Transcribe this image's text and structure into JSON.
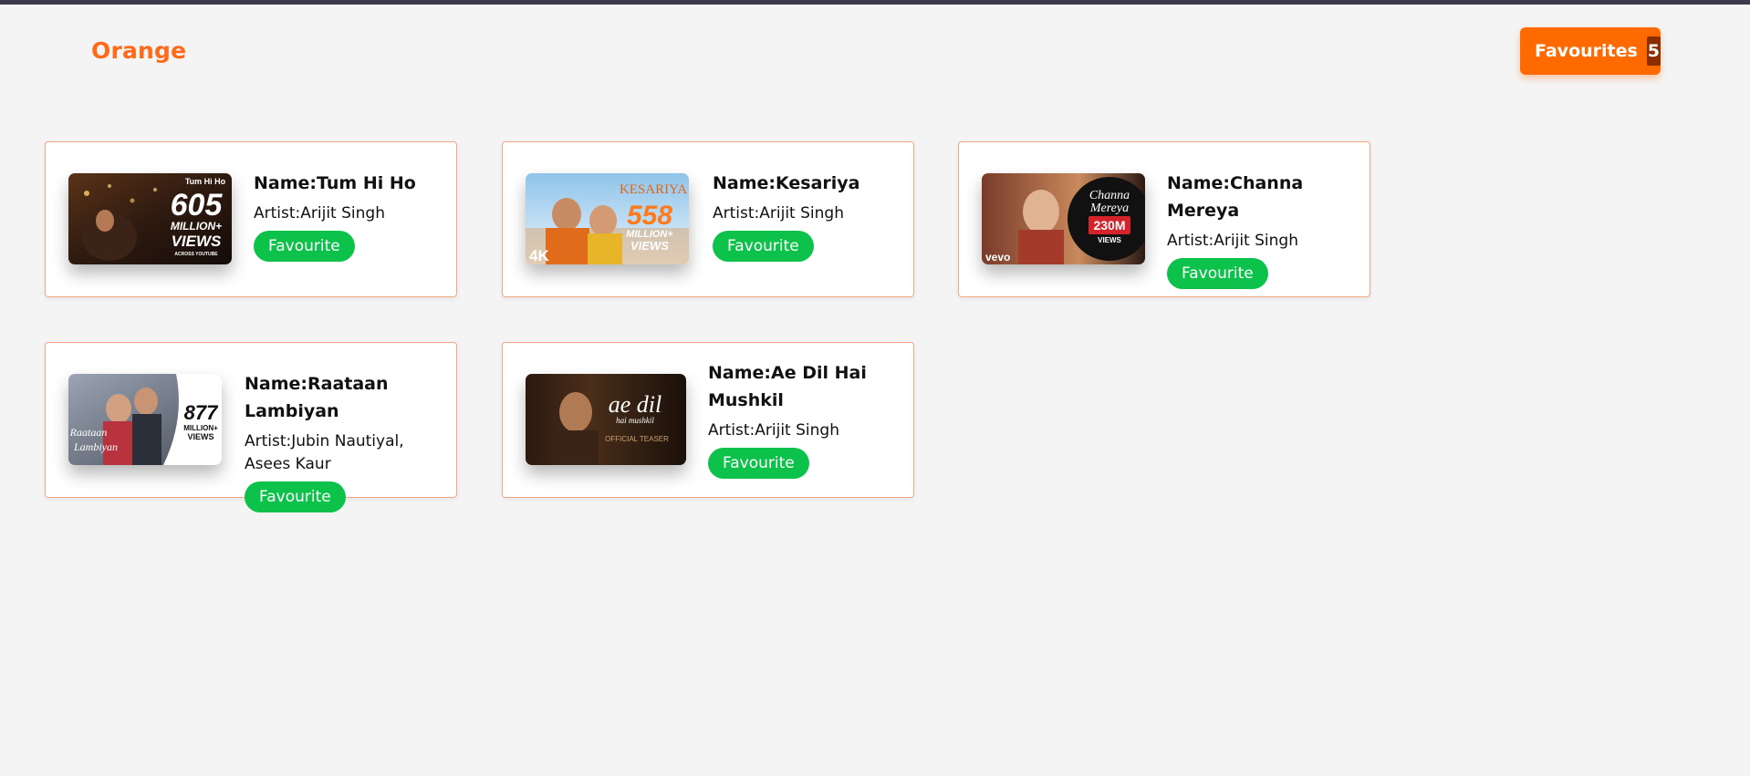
{
  "app": {
    "brand": "Orange"
  },
  "header": {
    "favourites_label": "Favourites",
    "favourites_count": "5"
  },
  "colors": {
    "accent": "#ff6a00",
    "brand_text": "#ff6a1a",
    "button_green": "#0cc24a",
    "card_border": "#f5a77e",
    "page_background": "#f4f4f4"
  },
  "songs": [
    {
      "name": "Name:Tum Hi Ho",
      "artist": "Artist:Arijit Singh",
      "button_label": "Favourite",
      "thumb": {
        "title": "Tum Hi Ho",
        "big": "605",
        "line1": "MILLION+",
        "line2": "VIEWS",
        "line3": "ACROSS YOUTUBE"
      }
    },
    {
      "name": "Name:Kesariya",
      "artist": "Artist:Arijit Singh",
      "button_label": "Favourite",
      "thumb": {
        "title": "KESARIYA",
        "big": "558",
        "line1": "MILLION+",
        "line2": "VIEWS",
        "badge": "4K"
      }
    },
    {
      "name": "Name:Channa Mereya",
      "artist": "Artist:Arijit Singh",
      "button_label": "Favourite",
      "thumb": {
        "title1": "Channa",
        "title2": "Mereya",
        "big": "230M",
        "line1": "VIEWS",
        "badge": "vevo"
      }
    },
    {
      "name": "Name:Raataan Lambiyan",
      "artist": "Artist:Jubin Nautiyal, Asees Kaur",
      "button_label": "Favourite",
      "thumb": {
        "title1": "Raataan",
        "title2": "Lambiyan",
        "big": "877",
        "line1": "MILLION+",
        "line2": "VIEWS"
      }
    },
    {
      "name": "Name:Ae Dil Hai Mushkil",
      "artist": "Artist:Arijit Singh",
      "button_label": "Favourite",
      "thumb": {
        "title1": "ae dil",
        "title2": "hai mushkil",
        "line1": "OFFICIAL TEASER"
      }
    }
  ]
}
